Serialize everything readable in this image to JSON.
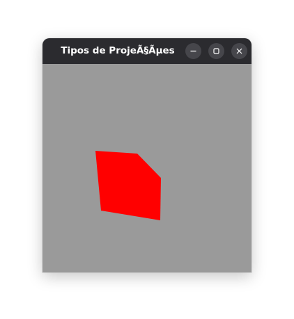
{
  "window": {
    "title": "Tipos de ProjeÃ§Ãµes"
  },
  "icons": {
    "minimize": "minimize-icon",
    "maximize": "maximize-icon",
    "close": "close-icon"
  },
  "colors": {
    "titlebar": "#2b2b2f",
    "canvas_background": "#9a9a9a",
    "shape_fill": "#ff0000"
  }
}
